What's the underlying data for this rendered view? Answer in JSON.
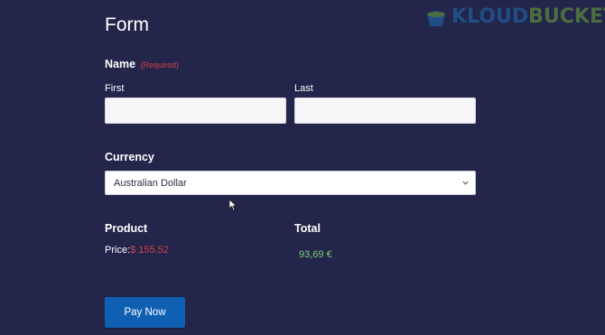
{
  "logo": {
    "part1": "KLOUD",
    "part2": "BUCKET"
  },
  "form": {
    "title": "Form",
    "name_label": "Name",
    "required_text": "(Required)",
    "first_label": "First",
    "last_label": "Last",
    "first_value": "",
    "last_value": "",
    "currency_label": "Currency",
    "currency_selected": "Australian Dollar",
    "product_label": "Product",
    "total_label": "Total",
    "price_prefix": "Price:",
    "price_value": "$ 155.52",
    "total_value": "93,69 €",
    "pay_button": "Pay Now"
  },
  "colors": {
    "background": "#23254a",
    "required": "#d6404c",
    "price": "#d6404c",
    "total": "#7fd07b",
    "button": "#0f5fb3"
  }
}
